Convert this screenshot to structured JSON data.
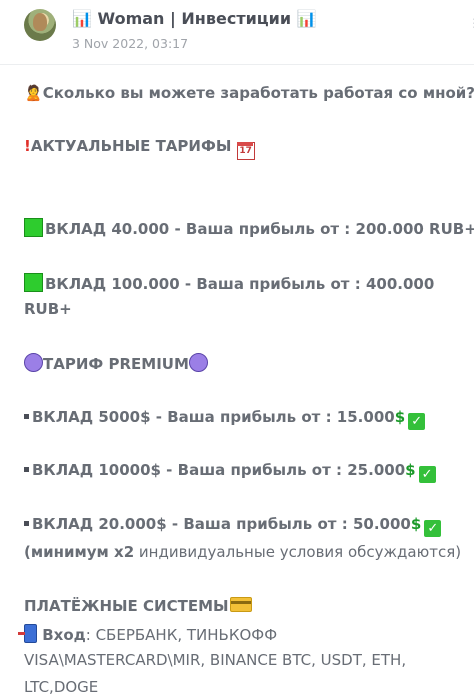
{
  "header": {
    "channel_title": "📊 Woman | Инвестиции 📊",
    "post_date": "3 Nov 2022, 03:17"
  },
  "post": {
    "question": "Сколько вы можете заработать работая со мной?",
    "tariffs_heading": "АКТУАЛЬНЫЕ ТАРИФЫ",
    "deposit_1": "ВКЛАД 40.000 - Ваша прибыль от : 200.000 RUB+",
    "deposit_2_line1": "ВКЛАД 100.000 - Ваша прибыль от : 400.000",
    "deposit_2_line2": "RUB+",
    "premium": "ТАРИФ PREMIUM",
    "premium_1": "ВКЛАД 5000$ - Ваша прибыль от : 15.000",
    "premium_2": "ВКЛАД 10000$ - Ваша прибыль от : 25.000",
    "premium_3": "ВКЛАД 20.000$ - Ваша прибыль от : 50.000",
    "premium_note_bold": "(минимум х2",
    "premium_note_rest": " индивидуальные условия обсуждаются)",
    "payments_heading": "ПЛАТЁЖНЫЕ СИСТЕМЫ",
    "input_label": "Вход",
    "input_line1": ": СБЕРБАНК, ТИНЬКОФФ",
    "input_line2": "VISA\\MASTERCARD\\MIR, BINANCE BTC, USDT, ETH,",
    "input_line3": "LTC,DOGE"
  },
  "icons": {
    "person": "person-icon",
    "exclamation": "exclamation-icon",
    "calendar": "calendar-icon",
    "green_square": "green-square-icon",
    "purple_circle": "purple-circle-icon",
    "dollar": "dollar-icon",
    "check": "check-icon",
    "credit_card": "credit-card-icon",
    "phone": "phone-icon"
  },
  "colors": {
    "title": "#4a4e57",
    "text": "#686d75",
    "date": "#a0a4aa"
  }
}
